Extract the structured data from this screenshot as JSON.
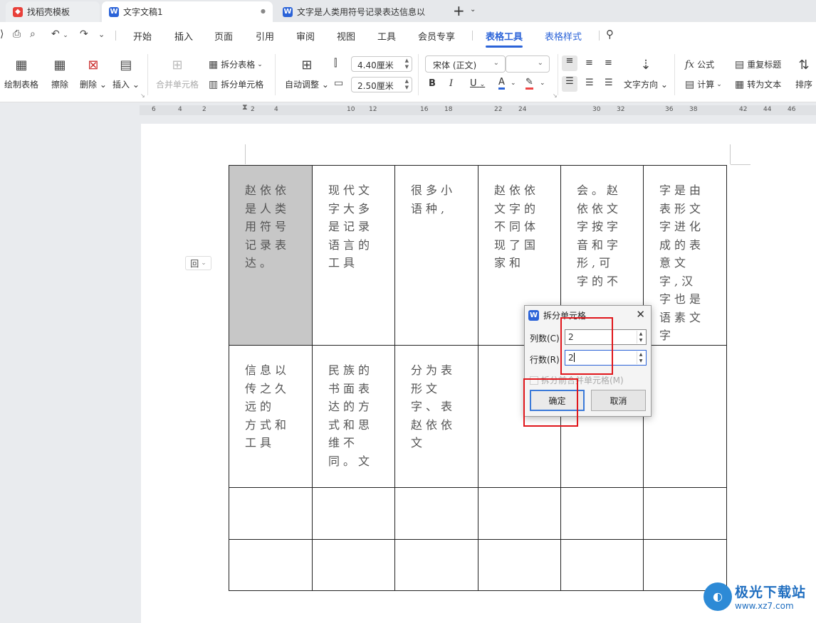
{
  "tabs": [
    {
      "label": "找稻壳模板",
      "icon": "docer-icon"
    },
    {
      "label": "文字文稿1",
      "icon": "W",
      "close": "●"
    },
    {
      "label": "文字是人类用符号记录表达信息以",
      "icon": "W"
    }
  ],
  "new_tab": "+",
  "menu": {
    "items": [
      "开始",
      "插入",
      "页面",
      "引用",
      "审阅",
      "视图",
      "工具",
      "会员专享",
      "表格工具",
      "表格样式"
    ],
    "active": "表格工具"
  },
  "ribbon": {
    "draw_table": "绘制表格",
    "erase": "擦除",
    "delete": "删除",
    "insert": "插入",
    "merge_cells": "合并单元格",
    "split_table": "拆分表格",
    "split_cells": "拆分单元格",
    "auto_fit": "自动调整",
    "width": "4.40厘米",
    "height": "2.50厘米",
    "font": "宋体 (正文)",
    "font_size": "",
    "bold": "B",
    "italic": "I",
    "underline": "U",
    "text_direction": "文字方向",
    "formula": "公式",
    "calc": "计算",
    "repeat_header": "重复标题",
    "to_text": "转为文本",
    "sort": "排序"
  },
  "ruler": [
    "6",
    "4",
    "2",
    "2",
    "4",
    "10",
    "12",
    "16",
    "18",
    "22",
    "24",
    "30",
    "32",
    "36",
    "38",
    "42",
    "44",
    "46"
  ],
  "table": [
    [
      "赵依依是人类用符号记录表达。",
      "现代文字大多是记录语言的工具",
      "很多小语种,",
      "赵依依文字的不同体现了国家和",
      "会。赵依依文字按字音和字形,可字的不",
      "字是由表形文字进化成的表意文字,汉字也是语素文字"
    ],
    [
      "信息以传之久远的 方式和工具",
      "民族的书面表达的方式和思维不同。文",
      "分为表形文字、表赵依依文",
      "",
      "",
      ""
    ],
    [
      "",
      "",
      "",
      "",
      "",
      ""
    ],
    [
      "",
      "",
      "",
      "",
      "",
      ""
    ]
  ],
  "handle": "回",
  "dialog": {
    "title": "拆分单元格",
    "cols_label": "列数(C):",
    "cols_value": "2",
    "rows_label": "行数(R):",
    "rows_value": "2",
    "merge_label": "拆分前合并单元格(M)",
    "ok": "确定",
    "cancel": "取消"
  },
  "watermark": {
    "name": "极光下载站",
    "url": "www.xz7.com"
  }
}
